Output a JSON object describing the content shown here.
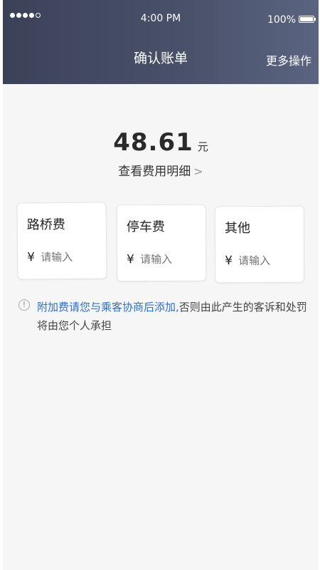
{
  "status_bar": {
    "time": "4:00 PM",
    "battery": "100%"
  },
  "nav": {
    "title": "确认账单",
    "more_label": "更多操作"
  },
  "amount": {
    "value": "48.61",
    "unit": "元",
    "detail_label": "查看费用明细",
    "detail_chevron": ">"
  },
  "fees": [
    {
      "label": "路桥费",
      "currency": "¥",
      "placeholder": "请输入"
    },
    {
      "label": "停车费",
      "currency": "¥",
      "placeholder": "请输入"
    },
    {
      "label": "其他",
      "currency": "¥",
      "placeholder": "请输入"
    }
  ],
  "notice": {
    "icon": "!",
    "highlight": "附加费请您与乘客协商后添加,",
    "rest": "否则由此产生的客诉和处罚将由您个人承担"
  },
  "colors": {
    "header": "#444b63",
    "highlight": "#2e70c9"
  }
}
